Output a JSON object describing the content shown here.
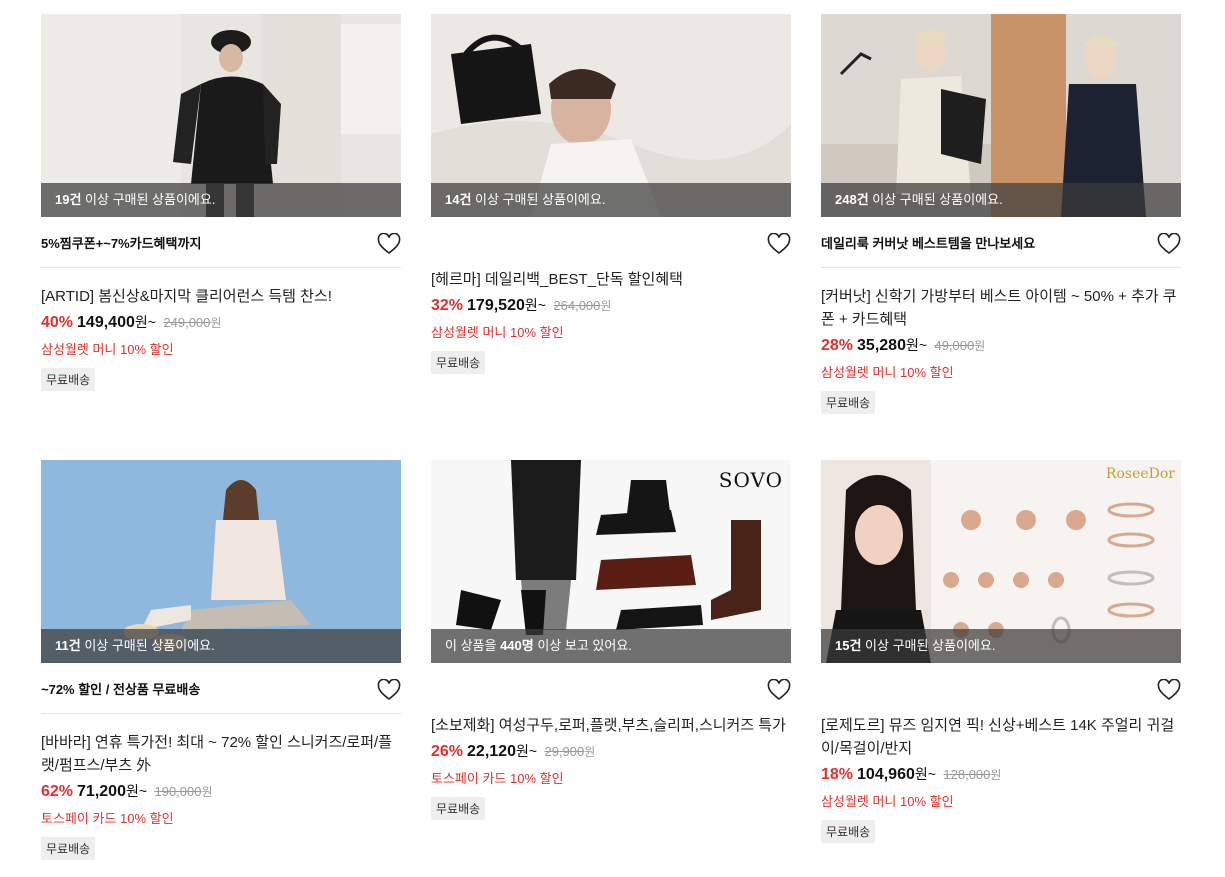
{
  "products": [
    {
      "overlay_count": "19건",
      "overlay_text": " 이상 구매된 상품이에요.",
      "promo": "5%찜쿠폰+~7%카드혜택까지",
      "title": "[ARTID] 봄신상&마지막 클리어런스 득템 찬스!",
      "discount_rate": "40%",
      "price": "149,400",
      "price_unit": "원~",
      "original_price": "249,000",
      "original_unit": "원",
      "benefit": "삼성월렛 머니 10% 할인",
      "tag": "무료배송"
    },
    {
      "overlay_count": "14건",
      "overlay_text": " 이상 구매된 상품이에요.",
      "promo": "",
      "title": "[헤르마] 데일리백_BEST_단독 할인혜택",
      "discount_rate": "32%",
      "price": "179,520",
      "price_unit": "원~",
      "original_price": "264,000",
      "original_unit": "원",
      "benefit": "삼성월렛 머니 10% 할인",
      "tag": "무료배송"
    },
    {
      "overlay_count": "248건",
      "overlay_text": " 이상 구매된 상품이에요.",
      "promo": "데일리룩 커버낫 베스트템을 만나보세요",
      "title": "[커버낫] 신학기 가방부터 베스트 아이템 ~ 50% + 추가 쿠폰 + 카드혜택",
      "discount_rate": "28%",
      "price": "35,280",
      "price_unit": "원~",
      "original_price": "49,000",
      "original_unit": "원",
      "benefit": "삼성월렛 머니 10% 할인",
      "tag": "무료배송"
    },
    {
      "overlay_count": "11건",
      "overlay_text": " 이상 구매된 상품이에요.",
      "promo": "~72% 할인 / 전상품 무료배송",
      "title": "[바바라] 연휴 특가전! 최대 ~ 72% 할인 스니커즈/로퍼/플랫/펌프스/부츠 外",
      "discount_rate": "62%",
      "price": "71,200",
      "price_unit": "원~",
      "original_price": "190,000",
      "original_unit": "원",
      "benefit": "토스페이 카드 10% 할인",
      "tag": "무료배송"
    },
    {
      "overlay_prefix": "이 상품을 ",
      "overlay_count": "440명",
      "overlay_text": " 이상 보고 있어요.",
      "promo": "",
      "brand_logo": "SOVO",
      "title": "[소보제화] 여성구두,로퍼,플랫,부츠,슬리퍼,스니커즈 특가",
      "discount_rate": "26%",
      "price": "22,120",
      "price_unit": "원~",
      "original_price": "29,900",
      "original_unit": "원",
      "benefit": "토스페이 카드 10% 할인",
      "tag": "무료배송"
    },
    {
      "overlay_count": "15건",
      "overlay_text": " 이상 구매된 상품이에요.",
      "promo": "",
      "brand_logo": "RoseeDor",
      "title": "[로제도르] 뮤즈 임지연 픽! 신상+베스트 14K 주얼리 귀걸이/목걸이/반지",
      "discount_rate": "18%",
      "price": "104,960",
      "price_unit": "원~",
      "original_price": "128,000",
      "original_unit": "원",
      "benefit": "삼성월렛 머니 10% 할인",
      "tag": "무료배송"
    }
  ],
  "icons": {
    "wishlist": "heart-outline-icon"
  },
  "colors": {
    "discount": "#e0312b",
    "benefit": "#e0312b",
    "overlay": "#3c3c3cb8"
  }
}
